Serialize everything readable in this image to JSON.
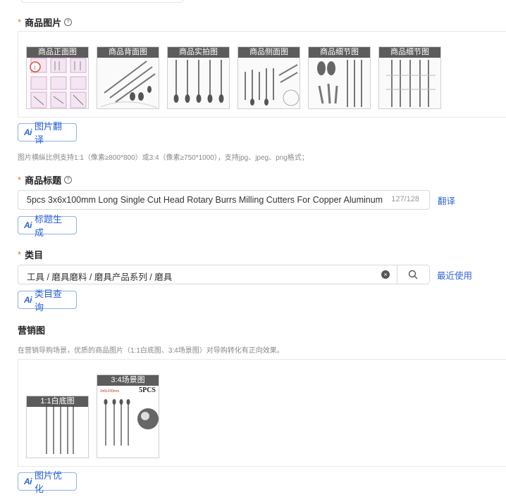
{
  "product_images": {
    "label": "商品图片",
    "thumbnails": [
      {
        "label": "商品正面图",
        "icon": "front-view-image"
      },
      {
        "label": "商品背面图",
        "icon": "back-view-image"
      },
      {
        "label": "商品实拍图",
        "icon": "real-shot-image"
      },
      {
        "label": "商品侧面图",
        "icon": "side-view-image"
      },
      {
        "label": "商品细节图",
        "icon": "detail-image"
      },
      {
        "label": "商品细节图",
        "icon": "detail-image"
      }
    ],
    "translate_button": "图片翻译",
    "hint": "图片横纵比例支持1:1（像素≥800*800）或3:4（像素≥750*1000），支持jpg、jpeg、png格式；"
  },
  "product_title": {
    "label": "商品标题",
    "value": "5pcs 3x6x100mm Long Single Cut Head Rotary Burrs Milling Cutters For Copper Aluminum ...",
    "counter": "127/128",
    "translate_link": "翻译",
    "generate_button": "标题生成"
  },
  "category": {
    "label": "类目",
    "value": "工具 / 磨具磨料 / 磨具产品系列 / 磨具",
    "recent_link": "最近使用",
    "query_button": "类目查询"
  },
  "marketing_images": {
    "label": "营销图",
    "hint": "在营销导购场景，优质的商品图片（1:1白底图、3:4场景图）对导购转化有正向效果。",
    "thumbnails": [
      {
        "label": "1:1白底图"
      },
      {
        "label": "3:4场景图",
        "overlay_text": "5PCS",
        "small_text": "3x6x100mm"
      }
    ],
    "optimize_button": "图片优化"
  },
  "colors": {
    "accent": "#2d63d6",
    "required": "#f56c2d",
    "label_bg": "#464646"
  }
}
